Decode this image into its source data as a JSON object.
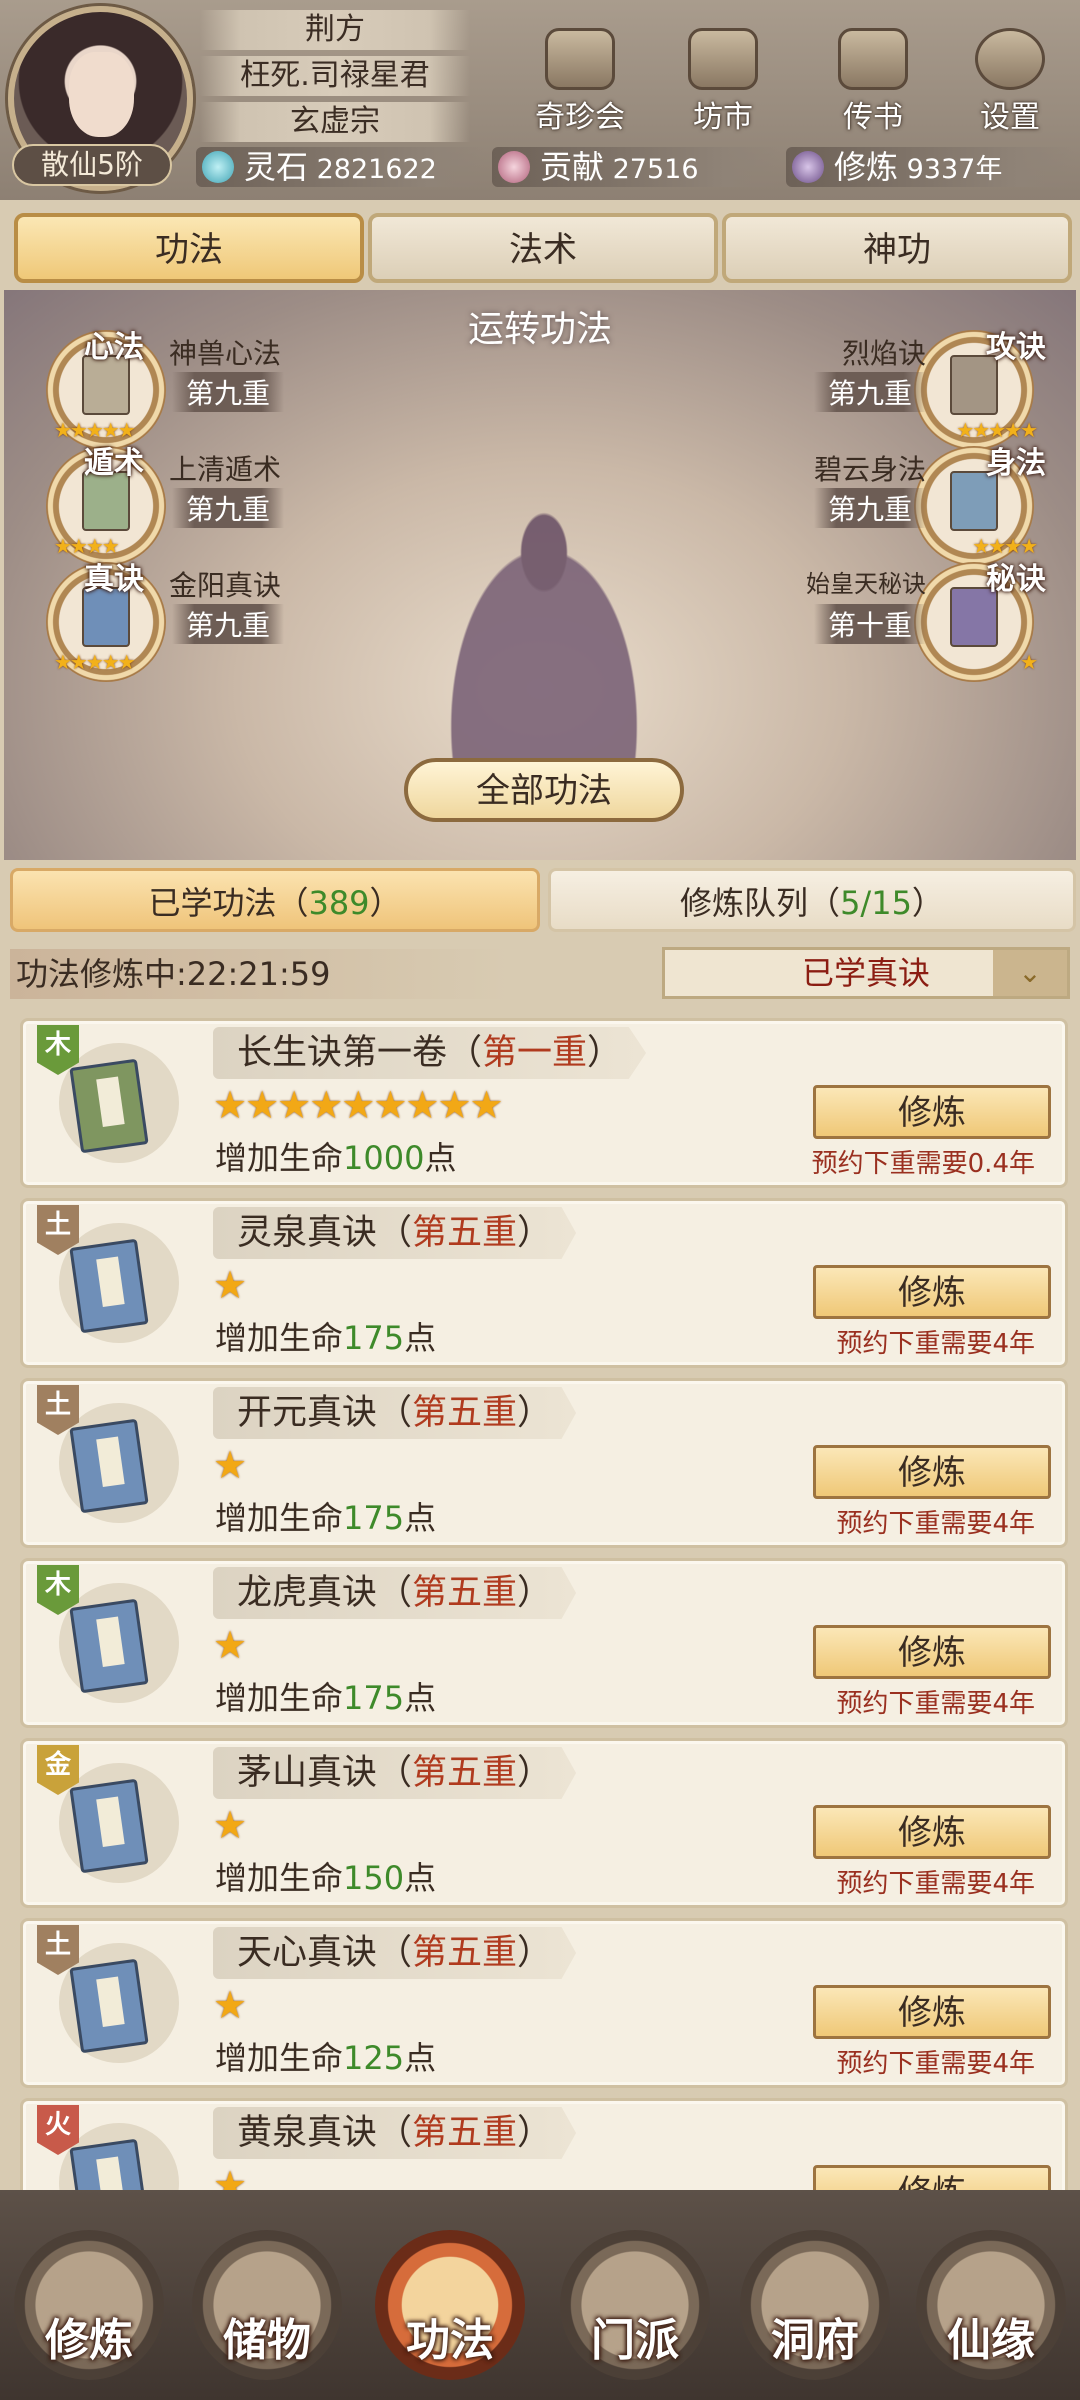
{
  "player": {
    "rank": "散仙5阶",
    "name": "荆方",
    "title": "枉死.司禄星君",
    "sect": "玄虚宗"
  },
  "top_buttons": [
    {
      "label": "奇珍会",
      "icon": "treasure-pavilion-icon"
    },
    {
      "label": "坊市",
      "icon": "market-icon"
    },
    {
      "label": "传书",
      "icon": "scroll-icon"
    },
    {
      "label": "设置",
      "icon": "gear-icon"
    }
  ],
  "resources": {
    "spirit_stone": {
      "label": "灵石",
      "value": "2821622"
    },
    "contribution": {
      "label": "贡献",
      "value": "27516"
    },
    "cultivation": {
      "label": "修炼",
      "value": "9337年"
    }
  },
  "main_tabs": [
    "功法",
    "法术",
    "神功"
  ],
  "scene": {
    "title": "运转功法",
    "all_button": "全部功法",
    "slots": [
      {
        "type": "心法",
        "name": "神兽心法",
        "level": "第九重",
        "stars": 5,
        "book_color": "#b9ad96"
      },
      {
        "type": "攻诀",
        "name": "烈焰诀",
        "level": "第九重",
        "stars": 5,
        "book_color": "#a39584"
      },
      {
        "type": "遁术",
        "name": "上清遁术",
        "level": "第九重",
        "stars": 4,
        "book_color": "#9cb08a"
      },
      {
        "type": "身法",
        "name": "碧云身法",
        "level": "第九重",
        "stars": 4,
        "book_color": "#7e9db8"
      },
      {
        "type": "真诀",
        "name": "金阳真诀",
        "level": "第九重",
        "stars": 5,
        "book_color": "#6f8fb8"
      },
      {
        "type": "秘诀",
        "name": "始皇天秘诀",
        "level": "第十重",
        "stars": 1,
        "book_color": "#8576a6"
      }
    ]
  },
  "sub_tabs": {
    "learned_label": "已学功法（",
    "learned_count": "389",
    "learned_suffix": "）",
    "queue_label": "修炼队列（",
    "queue_count": "5/15",
    "queue_suffix": "）"
  },
  "status": {
    "timer": "功法修炼中:22:21:59",
    "filter": "已学真诀"
  },
  "techniques": [
    {
      "element": "木",
      "element_color": "#6a9a3a",
      "name": "长生诀第一卷（",
      "level": "第一重",
      "close": "）",
      "stars": 9,
      "effect_prefix": "增加生命",
      "effect_value": "1000",
      "effect_suffix": "点",
      "button": "修炼",
      "note": "预约下重需要0.4年",
      "book_color": "#7f9660"
    },
    {
      "element": "土",
      "element_color": "#a08060",
      "name": "灵泉真诀（",
      "level": "第五重",
      "close": "）",
      "stars": 1,
      "effect_prefix": "增加生命",
      "effect_value": "175",
      "effect_suffix": "点",
      "button": "修炼",
      "note": "预约下重需要4年",
      "book_color": "#6f8fb8"
    },
    {
      "element": "土",
      "element_color": "#a08060",
      "name": "开元真诀（",
      "level": "第五重",
      "close": "）",
      "stars": 1,
      "effect_prefix": "增加生命",
      "effect_value": "175",
      "effect_suffix": "点",
      "button": "修炼",
      "note": "预约下重需要4年",
      "book_color": "#6f8fb8"
    },
    {
      "element": "木",
      "element_color": "#6a9a3a",
      "name": "龙虎真诀（",
      "level": "第五重",
      "close": "）",
      "stars": 1,
      "effect_prefix": "增加生命",
      "effect_value": "175",
      "effect_suffix": "点",
      "button": "修炼",
      "note": "预约下重需要4年",
      "book_color": "#6f8fb8"
    },
    {
      "element": "金",
      "element_color": "#c9a23a",
      "name": "茅山真诀（",
      "level": "第五重",
      "close": "）",
      "stars": 1,
      "effect_prefix": "增加生命",
      "effect_value": "150",
      "effect_suffix": "点",
      "button": "修炼",
      "note": "预约下重需要4年",
      "book_color": "#6f8fb8"
    },
    {
      "element": "土",
      "element_color": "#a08060",
      "name": "天心真诀（",
      "level": "第五重",
      "close": "）",
      "stars": 1,
      "effect_prefix": "增加生命",
      "effect_value": "125",
      "effect_suffix": "点",
      "button": "修炼",
      "note": "预约下重需要4年",
      "book_color": "#6f8fb8"
    },
    {
      "element": "火",
      "element_color": "#c85a4a",
      "name": "黄泉真诀（",
      "level": "第五重",
      "close": "）",
      "stars": 1,
      "effect_prefix": "",
      "effect_value": "",
      "effect_suffix": "",
      "button": "修炼",
      "note": "",
      "book_color": "#6f8fb8"
    }
  ],
  "bottom_nav": [
    {
      "label": "修炼",
      "active": false
    },
    {
      "label": "储物",
      "active": false
    },
    {
      "label": "功法",
      "active": true
    },
    {
      "label": "门派",
      "active": false
    },
    {
      "label": "洞府",
      "active": false
    },
    {
      "label": "仙缘",
      "active": false
    }
  ]
}
